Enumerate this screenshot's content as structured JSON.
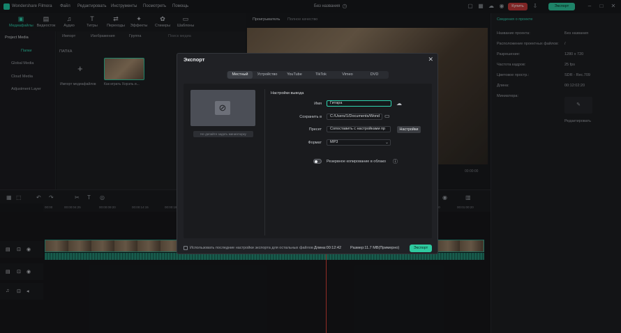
{
  "app": {
    "name": "Wondershare Filmora",
    "doc_title": "Без названия"
  },
  "menu": [
    "Файл",
    "Редактировать",
    "Инструменты",
    "Посмотреть",
    "Помощь"
  ],
  "top_buttons": {
    "buy": "Купить",
    "export": "Экспорт"
  },
  "toolbar": [
    "Медиафайлы",
    "Видеосток",
    "Аудио",
    "Титры",
    "Переходы",
    "Эффекты",
    "Стикеры",
    "Шаблоны"
  ],
  "left_panel": {
    "project_media": "Project Media",
    "folder": "Папки",
    "global_media": "Global Media",
    "cloud_media": "Cloud Media",
    "adjustment": "Adjustment Layer"
  },
  "media": {
    "import_btn": "Импорт",
    "filter1": "Изображения",
    "filter2": "Группа",
    "search_placeholder": "Поиск медиа",
    "section": "ПАПКА",
    "import_tile": "Импорт медиафайлов",
    "clip_name": "Как играть Хорэль и..."
  },
  "player_tabs": [
    "Проигрыватель",
    "Полное качество"
  ],
  "right_panel": {
    "tab": "Сведения о проекте",
    "rows": [
      {
        "label": "Название проекта:",
        "value": "Без названия"
      },
      {
        "label": "Расположение проектных файлов:",
        "value": "/"
      },
      {
        "label": "Разрешение:",
        "value": "1280 x 720"
      },
      {
        "label": "Частота кадров:",
        "value": "25 fps"
      },
      {
        "label": "Цветовое простр.:",
        "value": "SDR - Rec.709"
      },
      {
        "label": "Длина:",
        "value": "00:12:02:20"
      },
      {
        "label": "Миниатюра:",
        "value": ""
      }
    ],
    "edit_btn": "Редактировать"
  },
  "timeline": {
    "time_current": "00:00:00",
    "time_total": "00:00:00",
    "ticks": [
      "00:00",
      "00:00:04:25",
      "00:00:09:20",
      "00:00:14:15",
      "00:00:19:10",
      "00:01:00:00",
      "00:01:00:20"
    ]
  },
  "export_dialog": {
    "title": "Экспорт",
    "tabs": [
      "Местный",
      "Устройство",
      "YouTube",
      "TikTok",
      "Vimeo",
      "DVD"
    ],
    "active_tab": "Местный",
    "thumb_button": "Не делайте задать миниатюрку",
    "section": "Настройки вывода",
    "fields": {
      "name_label": "Имя",
      "name_value": "Гитара",
      "save_label": "Сохранить в",
      "save_value": "C:/Users/1/Documents/Wond",
      "preset_label": "Пресет",
      "preset_value": "Сопоставить с настройками пр",
      "settings_btn": "Настройки",
      "format_label": "Формат",
      "format_value": "MP3"
    },
    "backup_label": "Резервное копирование в облако",
    "footer_note": "Использовать последние настройки экспорта для остальных файлов",
    "duration": "Длина:00:12:42",
    "size": "Размер:11.7 MB(Примерно)",
    "export_btn": "Экспорт"
  },
  "colors": {
    "accent": "#2fcaa0",
    "buy": "#c43a3a",
    "playhead": "#e0453b"
  }
}
